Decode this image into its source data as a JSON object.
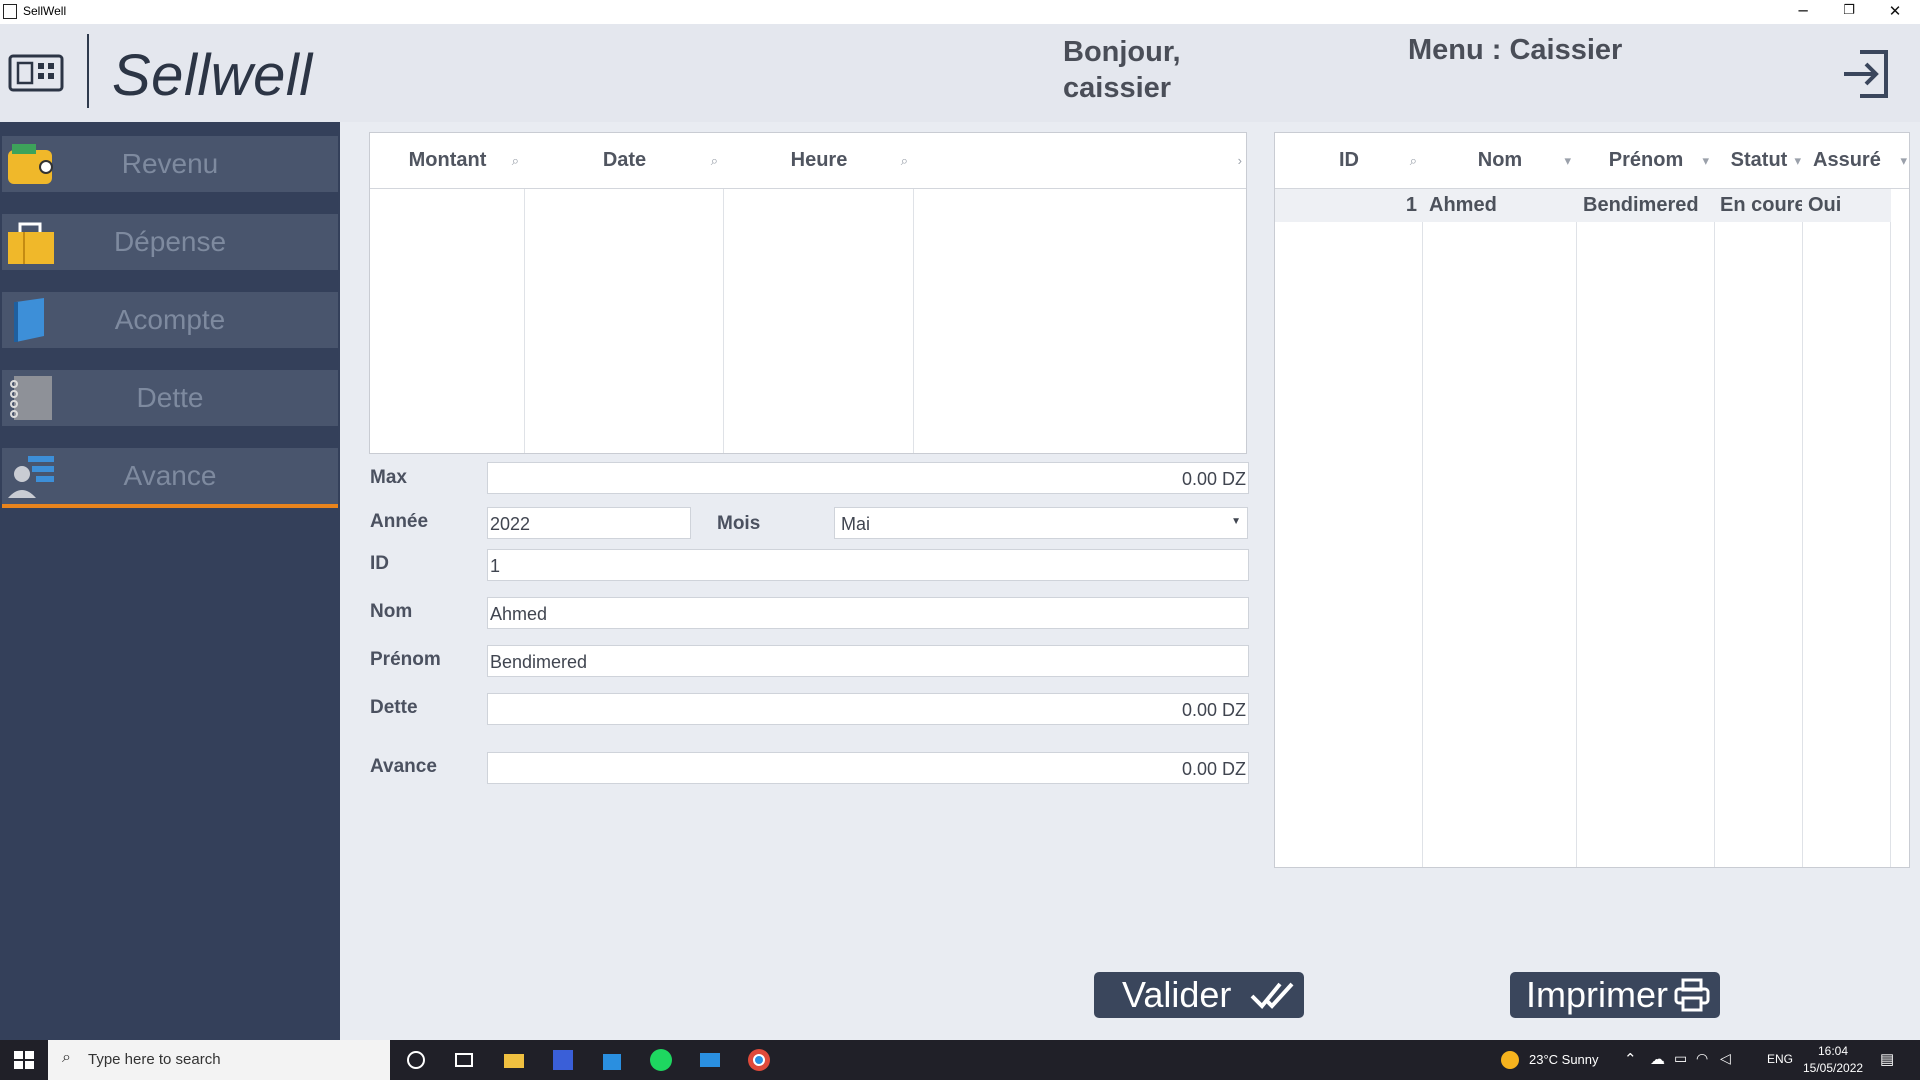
{
  "window": {
    "title": "SellWell",
    "minimize": "─",
    "restore": "❐",
    "close": "✕"
  },
  "header": {
    "brand": "Sellwell",
    "greeting": "Bonjour, caissier",
    "menu_label": "Menu : Caissier",
    "logout_icon": "logout-icon"
  },
  "sidebar": {
    "items": [
      {
        "label": "Revenu",
        "icon": "wallet-icon"
      },
      {
        "label": "Dépense",
        "icon": "shopping-bag-icon"
      },
      {
        "label": "Acompte",
        "icon": "book-icon"
      },
      {
        "label": "Dette",
        "icon": "notebook-icon"
      },
      {
        "label": "Avance",
        "icon": "user-list-icon",
        "active": true
      }
    ]
  },
  "payments_grid": {
    "columns": [
      "Montant",
      "Date",
      "Heure"
    ],
    "rows": []
  },
  "form": {
    "max_label": "Max",
    "max_value": "0.00 DZ",
    "annee_label": "Année",
    "annee_value": "2022",
    "mois_label": "Mois",
    "mois_value": "Mai",
    "id_label": "ID",
    "id_value": "1",
    "nom_label": "Nom",
    "nom_value": "Ahmed",
    "prenom_label": "Prénom",
    "prenom_value": "Bendimered",
    "dette_label": "Dette",
    "dette_value": "0.00 DZ",
    "avance_label": "Avance",
    "avance_value": "0.00 DZ"
  },
  "employees_grid": {
    "columns": [
      "ID",
      "Nom",
      "Prénom",
      "Statut",
      "Assuré"
    ],
    "rows": [
      {
        "id": "1",
        "nom": "Ahmed",
        "prenom": "Bendimered",
        "statut": "En coure",
        "assure": "Oui"
      }
    ]
  },
  "buttons": {
    "valider": "Valider",
    "imprimer": "Imprimer"
  },
  "taskbar": {
    "search_placeholder": "Type here to search",
    "weather": "23°C  Sunny",
    "lang": "ENG",
    "time": "16:04",
    "date": "15/05/2022"
  },
  "colors": {
    "sidebar": "#34405a",
    "nav_item": "#49556d",
    "accent": "#e8841d",
    "button": "#3a465c"
  }
}
